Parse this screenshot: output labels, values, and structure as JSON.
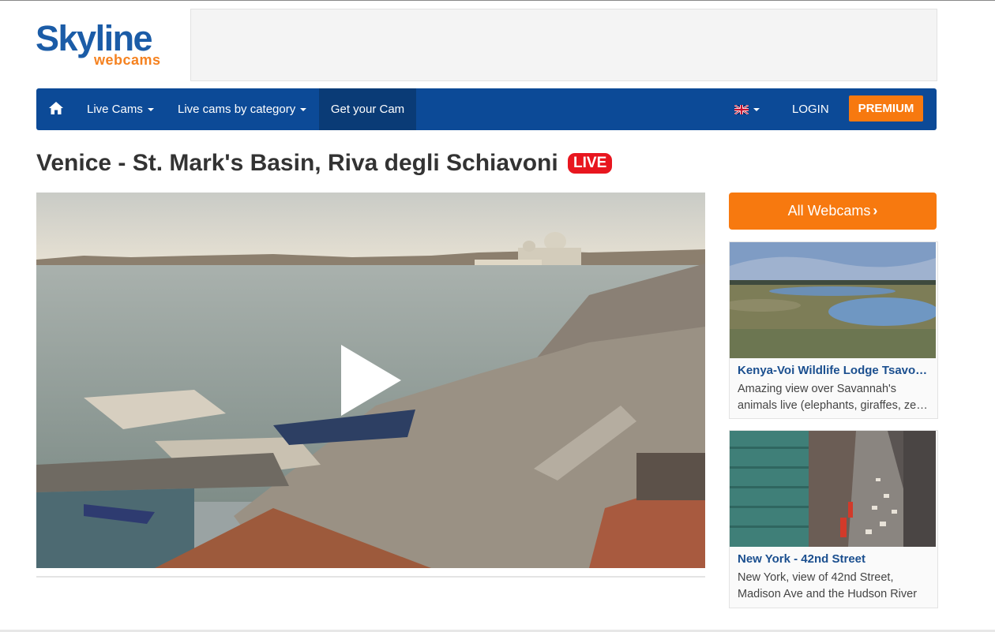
{
  "logo": {
    "main": "Skyline",
    "sub": "webcams"
  },
  "nav": {
    "home_icon": "home-icon",
    "live_cams": "Live Cams",
    "by_category": "Live cams by category",
    "get_cam": "Get your Cam",
    "language_flag": "uk-flag-icon",
    "login": "LOGIN",
    "premium": "PREMIUM"
  },
  "page": {
    "title": "Venice - St. Mark's Basin, Riva degli Schiavoni",
    "live_badge": "LIVE"
  },
  "player": {
    "play_icon": "play-icon"
  },
  "sidebar": {
    "all_webcams": "All Webcams",
    "all_webcams_icon": "chevron-right-icon",
    "cards": [
      {
        "title": "Kenya-Voi Wildlife Lodge Tsavo East",
        "desc_line1": "Amazing view over Savannah's",
        "desc_line2": "animals live (elephants, giraffes, zebras)"
      },
      {
        "title": "New York - 42nd Street",
        "desc_line1": "New York, view of 42nd Street,",
        "desc_line2": "Madison Ave and the Hudson River"
      }
    ]
  },
  "colors": {
    "brand_blue": "#1b5ca7",
    "nav_blue": "#0c4a97",
    "accent_orange": "#f7790f",
    "live_red": "#e8161f"
  }
}
